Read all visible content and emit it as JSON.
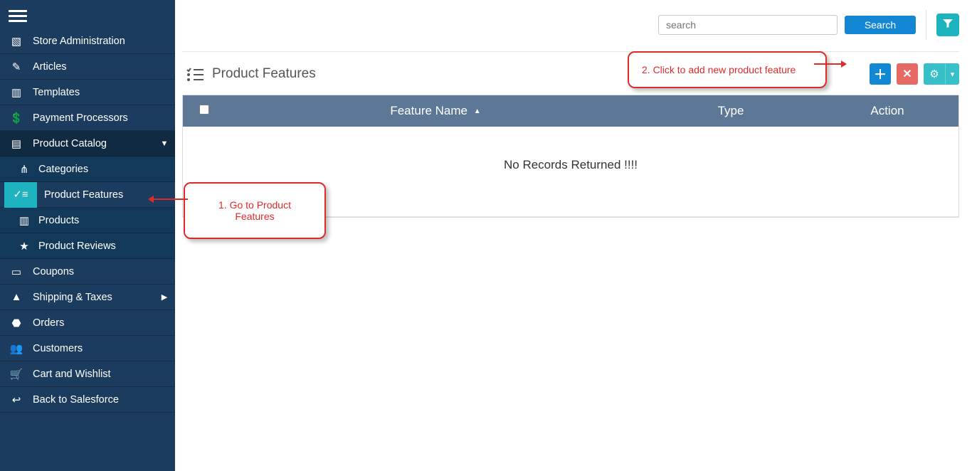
{
  "search": {
    "placeholder": "search",
    "button_label": "Search"
  },
  "page": {
    "title": "Product Features",
    "table": {
      "col_name": "Feature Name",
      "col_type": "Type",
      "col_action": "Action",
      "empty_message": "No Records Returned !!!!"
    }
  },
  "callouts": {
    "c1": "1. Go to Product Features",
    "c2": "2.  Click to add new product  feature"
  },
  "sidebar": {
    "items": [
      {
        "icon": "▧",
        "label": "Store Administration"
      },
      {
        "icon": "✎",
        "label": "Articles"
      },
      {
        "icon": "▥",
        "label": "Templates"
      },
      {
        "icon": "💲",
        "label": "Payment Processors"
      },
      {
        "icon": "▤",
        "label": "Product Catalog",
        "expanded": true,
        "caret": "▼",
        "children": [
          {
            "icon": "⋔",
            "label": "Categories"
          },
          {
            "icon": "✓≡",
            "label": "Product Features",
            "active": true
          },
          {
            "icon": "▥",
            "label": "Products"
          },
          {
            "icon": "★",
            "label": "Product Reviews"
          }
        ]
      },
      {
        "icon": "▭",
        "label": "Coupons"
      },
      {
        "icon": "▲",
        "label": "Shipping & Taxes",
        "caret": "▶"
      },
      {
        "icon": "⬣",
        "label": "Orders"
      },
      {
        "icon": "👥",
        "label": "Customers"
      },
      {
        "icon": "🛒",
        "label": "Cart and Wishlist"
      },
      {
        "icon": "↩",
        "label": "Back to Salesforce"
      }
    ]
  }
}
